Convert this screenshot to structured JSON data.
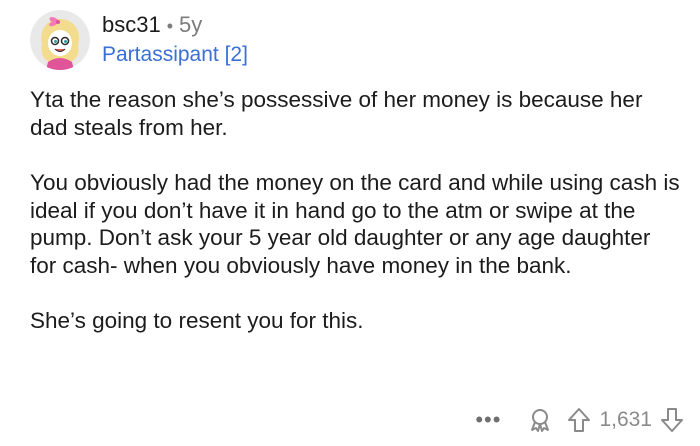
{
  "comment": {
    "username": "bsc31",
    "separator": "•",
    "age": "5y",
    "flair": "Partassipant [2]",
    "paragraphs": [
      "Yta the reason she’s possessive of her money is because her dad steals from her.",
      "You obviously had the money on the card and while using cash is ideal if you don’t have it in hand go to the atm or swipe at the pump. Don’t ask your 5 year old daughter or any age daughter for cash- when you obviously have money in the bank.",
      "She’s going to resent you for this."
    ]
  },
  "actions": {
    "more": "•••",
    "score": "1,631",
    "award_icon": "award-icon",
    "upvote_icon": "upvote-arrow-icon",
    "downvote_icon": "downvote-arrow-icon"
  },
  "colors": {
    "text": "#1c1c1c",
    "muted": "#7c7c7c",
    "flair": "#3a6fd6"
  }
}
